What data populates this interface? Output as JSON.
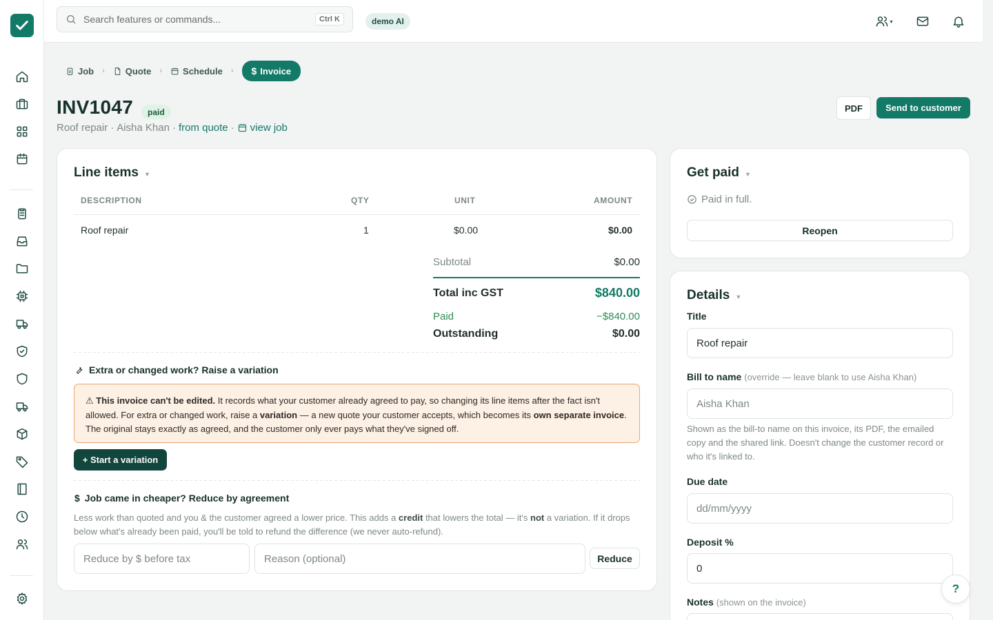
{
  "colors": {
    "accent": "#137a68",
    "dark_accent": "#11463d",
    "paid_green": "#2e8b57",
    "warning_bg": "#fdf0e4",
    "warning_border": "#e8a66c"
  },
  "sidebar": {
    "icons": [
      "home-icon",
      "briefcase-icon",
      "grid-icon",
      "calendar-icon",
      "clipboard-icon",
      "inbox-icon",
      "folder-icon",
      "chip-icon",
      "truck-icon",
      "shield-check-icon",
      "shield-icon",
      "truck-icon",
      "box-icon",
      "tag-icon",
      "book-icon",
      "clock-icon",
      "users-icon",
      "gear-icon"
    ]
  },
  "topbar": {
    "search_placeholder": "Search features or commands...",
    "search_shortcut": "Ctrl K",
    "demo_badge": "demo AI"
  },
  "breadcrumb": {
    "job": "Job",
    "quote": "Quote",
    "schedule": "Schedule",
    "invoice": "Invoice"
  },
  "invoice": {
    "number": "INV1047",
    "status": "paid",
    "job_title": "Roof repair",
    "customer": "Aisha Khan",
    "sep": "·",
    "from_quote": "from quote",
    "view_job": "view job"
  },
  "actions": {
    "pdf": "PDF",
    "send": "Send to customer"
  },
  "line_items": {
    "heading": "Line items",
    "columns": [
      "DESCRIPTION",
      "QTY",
      "UNIT",
      "AMOUNT"
    ],
    "rows": [
      {
        "description": "Roof repair",
        "qty": "1",
        "unit": "$0.00",
        "amount": "$0.00"
      }
    ],
    "subtotal_label": "Subtotal",
    "subtotal_value": "$0.00",
    "total_label": "Total inc GST",
    "total_value": "$840.00",
    "paid_label": "Paid",
    "paid_value": "−$840.00",
    "outstanding_label": "Outstanding",
    "outstanding_value": "$0.00"
  },
  "variation": {
    "heading": "Extra or changed work? Raise a variation",
    "warning_bold1": "This invoice can't be edited.",
    "warning_text1": " It records what your customer already agreed to pay, so changing its line items after the fact isn't allowed. For extra or changed work, raise a ",
    "warning_bold2": "variation",
    "warning_text2": " — a new quote your customer accepts, which becomes its ",
    "warning_bold3": "own separate invoice",
    "warning_text3": ". The original stays exactly as agreed, and the customer only ever pays what they've signed off.",
    "button": "+ Start a variation"
  },
  "reduce": {
    "heading": "Job came in cheaper? Reduce by agreement",
    "text1": "Less work than quoted and you & the customer agreed a lower price. This adds a ",
    "bold1": "credit",
    "text2": " that lowers the total — it's ",
    "bold2": "not",
    "text3": " a variation. If it drops below what's already been paid, you'll be told to refund the difference (we never auto-refund).",
    "amount_placeholder": "Reduce by $ before tax",
    "reason_placeholder": "Reason (optional)",
    "button": "Reduce"
  },
  "get_paid": {
    "heading": "Get paid",
    "status": "Paid in full.",
    "reopen": "Reopen"
  },
  "details": {
    "heading": "Details",
    "title_label": "Title",
    "title_value": "Roof repair",
    "bill_to_label": "Bill to name",
    "bill_to_hint": "(override — leave blank to use Aisha Khan)",
    "bill_to_placeholder": "Aisha Khan",
    "bill_to_help": "Shown as the bill-to name on this invoice, its PDF, the emailed copy and the shared link. Doesn't change the customer record or who it's linked to.",
    "due_label": "Due date",
    "due_placeholder": "dd/mm/yyyy",
    "deposit_label": "Deposit %",
    "deposit_value": "0",
    "notes_label": "Notes",
    "notes_hint": "(shown on the invoice)"
  },
  "help": "?"
}
